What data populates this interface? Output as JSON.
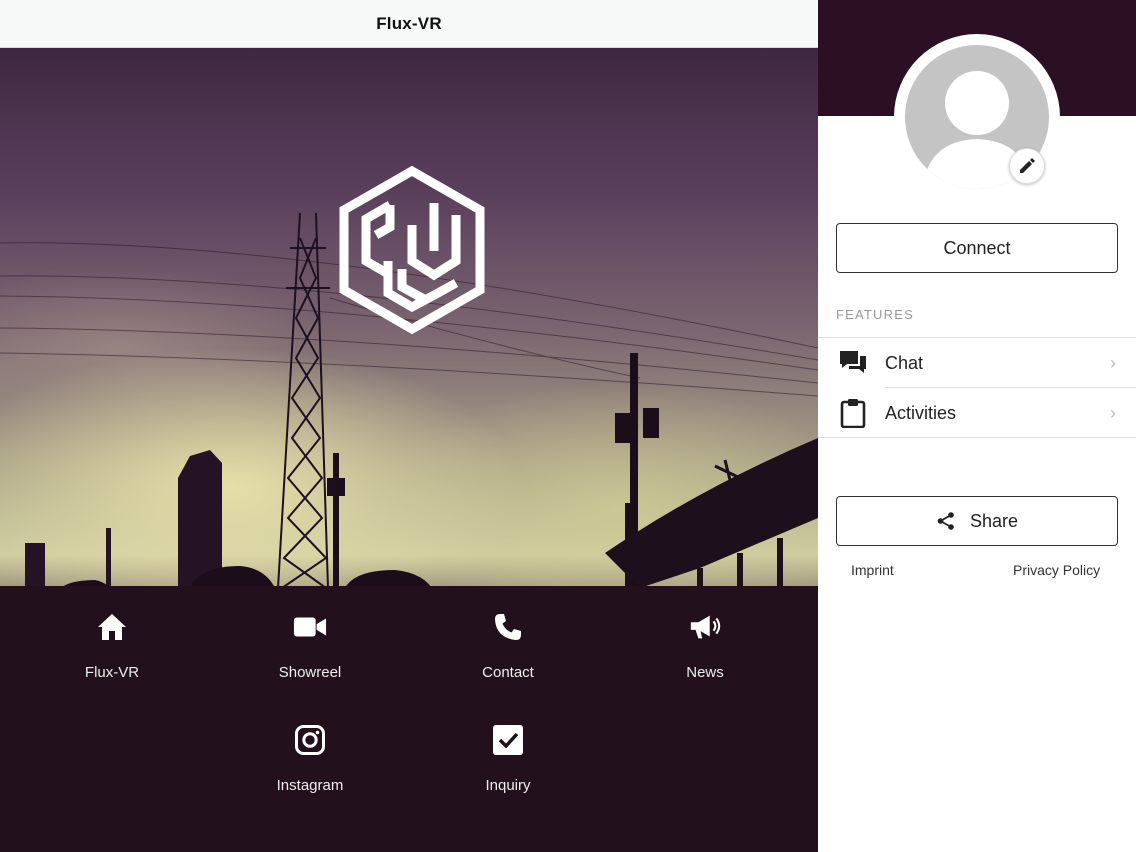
{
  "header": {
    "title": "Flux-VR"
  },
  "nav_items": [
    {
      "label": "Flux-VR",
      "icon": "home-icon"
    },
    {
      "label": "Showreel",
      "icon": "video-camera-icon"
    },
    {
      "label": "Contact",
      "icon": "phone-icon"
    },
    {
      "label": "News",
      "icon": "megaphone-icon"
    },
    {
      "label": "Instagram",
      "icon": "instagram-icon"
    },
    {
      "label": "Inquiry",
      "icon": "checkbox-icon"
    }
  ],
  "sidebar": {
    "connect_label": "Connect",
    "features_heading": "FEATURES",
    "features": [
      {
        "label": "Chat",
        "icon": "chat-icon"
      },
      {
        "label": "Activities",
        "icon": "clipboard-icon"
      }
    ],
    "share_label": "Share",
    "imprint_label": "Imprint",
    "privacy_label": "Privacy Policy"
  },
  "colors": {
    "accent": "#2a1022",
    "nav_background": "#22101d",
    "topbar_background": "#f7f8f8"
  }
}
